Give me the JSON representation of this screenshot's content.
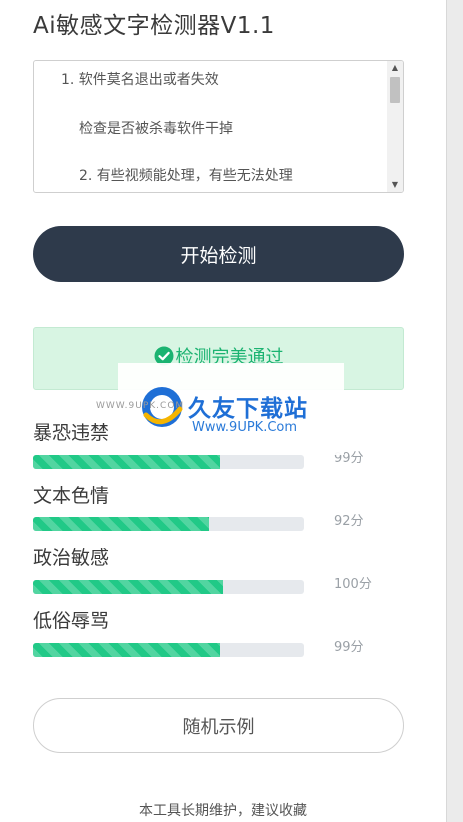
{
  "app": {
    "title": "Ai敏感文字检测器V1.1"
  },
  "notes": {
    "lines": [
      "1. 软件莫名退出或者失效",
      "检查是否被杀毒软件干掉",
      "2. 有些视频能处理，有些无法处理"
    ]
  },
  "actions": {
    "start_label": "开始检测",
    "random_label": "随机示例"
  },
  "result": {
    "text": "检测完美通过",
    "color": "#1bb371"
  },
  "metrics": [
    {
      "label": "暴恐违禁",
      "score_text": "99分",
      "fill": 0.69
    },
    {
      "label": "文本色情",
      "score_text": "92分",
      "fill": 0.65
    },
    {
      "label": "政治敏感",
      "score_text": "100分",
      "fill": 0.7
    },
    {
      "label": "低俗辱骂",
      "score_text": "99分",
      "fill": 0.69
    }
  ],
  "footer": {
    "text": "本工具长期维护，建议收藏"
  },
  "watermark": {
    "brand": "久友下载站",
    "url": "Www.9UPK.Com",
    "left_url": "WWW.9UPK.COM"
  },
  "colors": {
    "button_dark": "#2e3a4b",
    "bar_fill": "#21c987",
    "success_bg": "#d8f5e3"
  }
}
